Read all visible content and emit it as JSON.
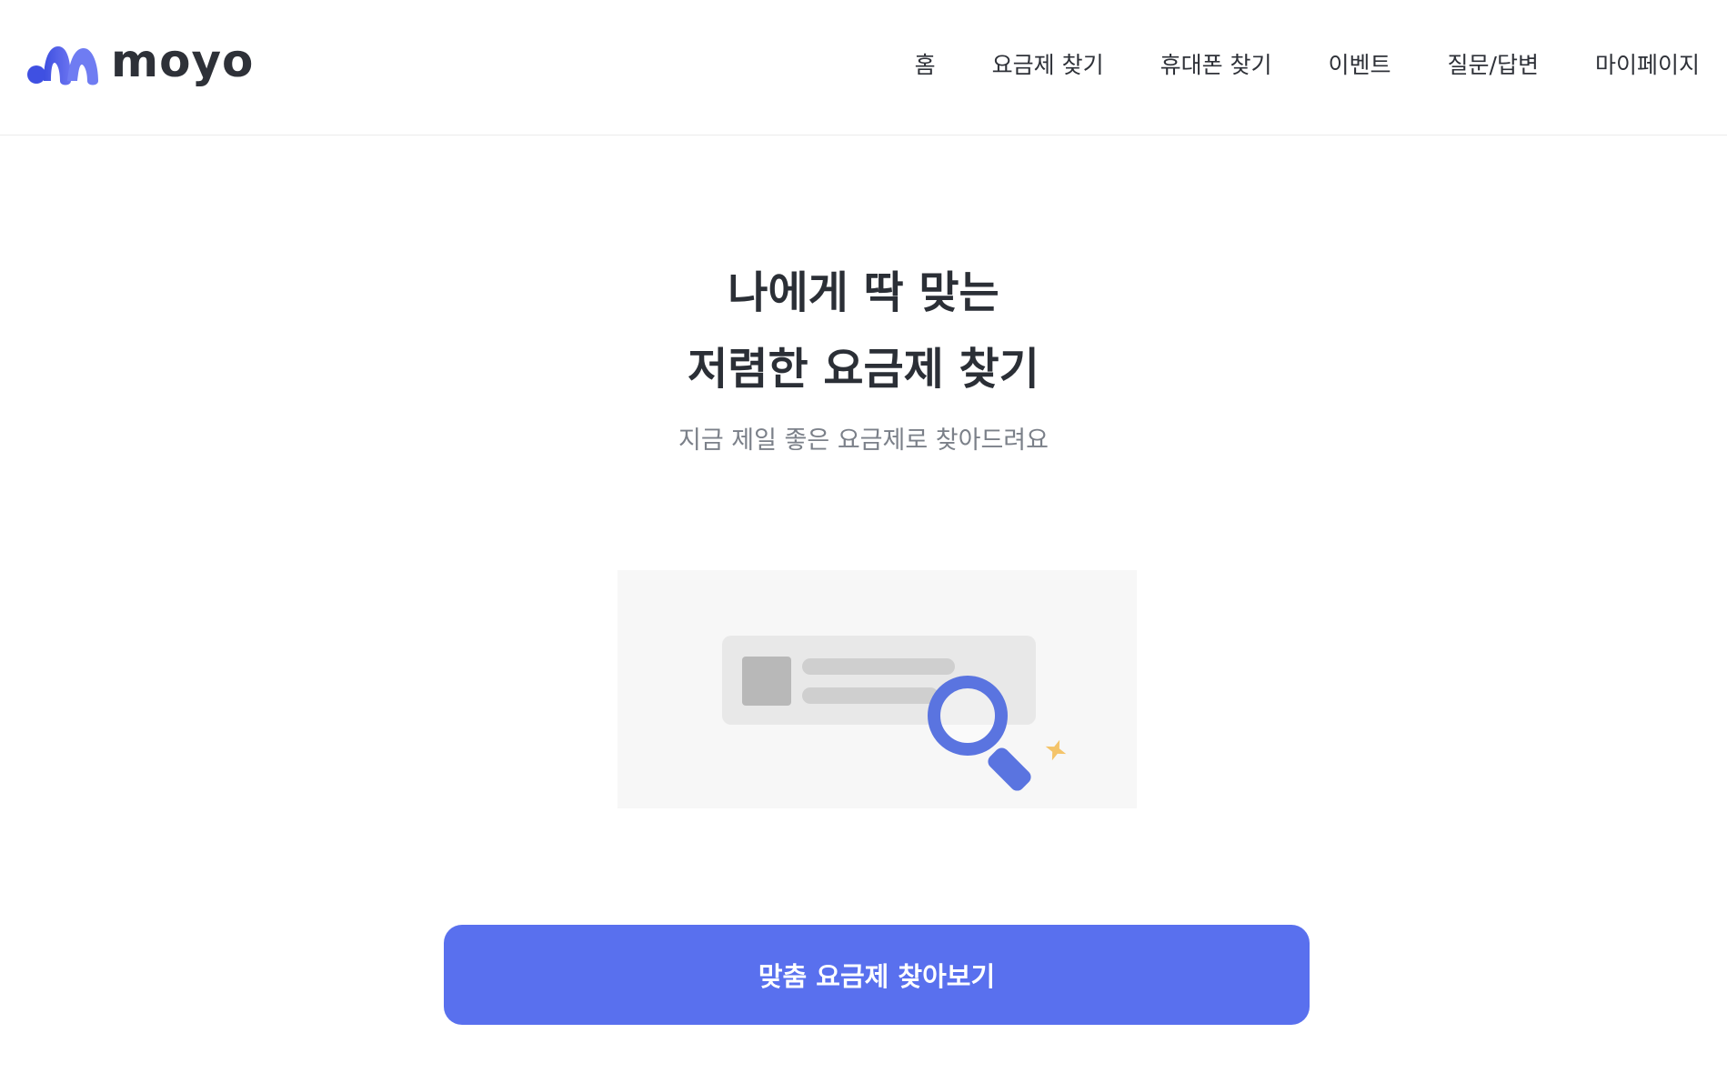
{
  "header": {
    "logo_text": "moyo",
    "nav": [
      {
        "label": "홈"
      },
      {
        "label": "요금제 찾기"
      },
      {
        "label": "휴대폰 찾기"
      },
      {
        "label": "이벤트"
      },
      {
        "label": "질문/답변"
      },
      {
        "label": "마이페이지"
      }
    ]
  },
  "hero": {
    "title_line1": "나에게 딱 맞는",
    "title_line2": "저렴한 요금제 찾기",
    "subtitle": "지금 제일 좋은 요금제로 찾아드려요"
  },
  "illustration": {
    "icon": "magnifier-search-icon",
    "accent_color": "#5a74e0",
    "sparkle_color": "#f4c46a"
  },
  "cta": {
    "label": "맞춤 요금제 찾아보기",
    "color": "#5970ee"
  },
  "colors": {
    "brand": "#4a5ce6",
    "text": "#2e3138",
    "subtext": "#7b8089"
  }
}
